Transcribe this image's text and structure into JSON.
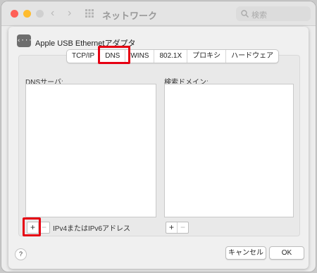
{
  "window": {
    "title": "ネットワーク",
    "search_placeholder": "検索",
    "nav_back": "‹",
    "nav_forward": "›"
  },
  "sheet": {
    "interface_icon_text": "‹···›",
    "interface_name": "Apple USB Ethernetアダプタ",
    "tabs": [
      {
        "label": "TCP/IP"
      },
      {
        "label": "DNS"
      },
      {
        "label": "WINS"
      },
      {
        "label": "802.1X"
      },
      {
        "label": "プロキシ"
      },
      {
        "label": "ハードウェア"
      }
    ],
    "selected_tab": "DNS",
    "dns_servers": {
      "label": "DNSサーバ:",
      "items": []
    },
    "search_domains": {
      "label": "検索ドメイン:",
      "items": []
    },
    "plus": "+",
    "minus": "−",
    "dns_hint": "IPv4またはIPv6アドレス",
    "help": "?",
    "cancel": "キャンセル",
    "ok": "OK"
  },
  "colors": {
    "highlight": "#e60012"
  }
}
